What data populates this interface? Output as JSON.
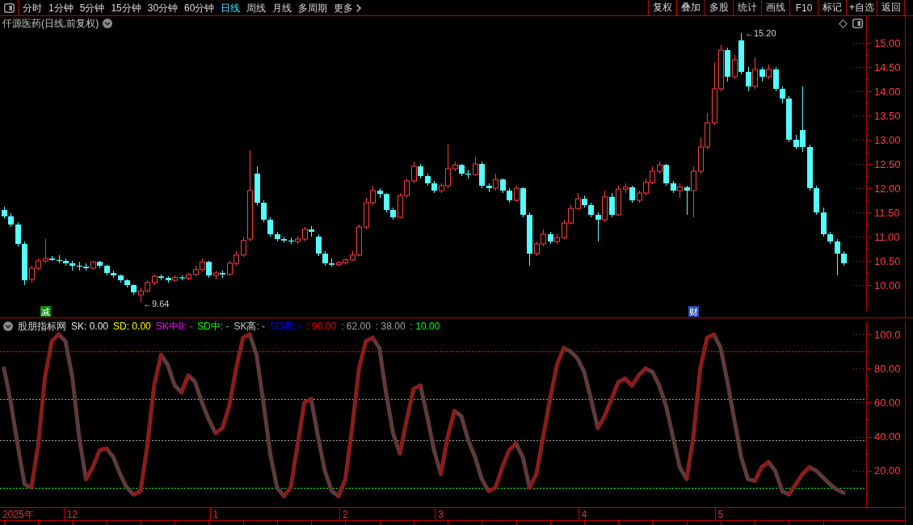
{
  "toolbar": {
    "tabs": [
      {
        "label": "分时",
        "selected": false,
        "kind": "period"
      },
      {
        "label": "1分钟",
        "selected": false,
        "kind": "period"
      },
      {
        "label": "5分钟",
        "selected": false,
        "kind": "period"
      },
      {
        "label": "15分钟",
        "selected": false,
        "kind": "period"
      },
      {
        "label": "30分钟",
        "selected": false,
        "kind": "period"
      },
      {
        "label": "60分钟",
        "selected": false,
        "kind": "period"
      },
      {
        "label": "日线",
        "selected": true,
        "kind": "period"
      },
      {
        "label": "周线",
        "selected": false,
        "kind": "period"
      },
      {
        "label": "月线",
        "selected": false,
        "kind": "period"
      },
      {
        "label": "多周期",
        "selected": false,
        "kind": "period"
      },
      {
        "label": "更多",
        "selected": false,
        "kind": "menu"
      }
    ],
    "buttons": [
      "复权",
      "叠加",
      "多股",
      "统计",
      "画线",
      "F10",
      "标记",
      "+自选",
      "返回"
    ]
  },
  "price_chart": {
    "title": "仟源医药(日线,前复权)",
    "axis_labels": [
      "15.00",
      "14.50",
      "14.00",
      "13.50",
      "13.00",
      "12.50",
      "12.00",
      "11.50",
      "11.00",
      "10.50",
      "10.00"
    ],
    "high_label": "←15.20",
    "low_label": "←9.64",
    "events": [
      {
        "label": "减",
        "color": "#0a8f0a"
      },
      {
        "label": "财",
        "color": "#2a52be"
      }
    ]
  },
  "indicator": {
    "name": "股朋指标网",
    "legend": [
      {
        "text": "SK: 0.00",
        "color": "#e6e6e6"
      },
      {
        "text": "SD: 0.00",
        "color": "#ffff00"
      },
      {
        "text": "SK中8: -",
        "color": "#ff00ff"
      },
      {
        "text": "SD中: -",
        "color": "#00ff00"
      },
      {
        "text": "SK高: -",
        "color": "#c8c8c8"
      },
      {
        "text": "SD高: -",
        "color": "#0000ff"
      },
      {
        "text": ": 90.00",
        "color": "#ff0000"
      },
      {
        "text": ": 62.00",
        "color": "#a0a0a0"
      },
      {
        "text": ": 38.00",
        "color": "#a0a0a0"
      },
      {
        "text": ": 10.00",
        "color": "#00ff00"
      }
    ],
    "year_label": "2025年",
    "chart_data": {
      "type": "line",
      "categories": [
        null,
        null,
        null,
        null,
        null,
        null,
        null,
        null,
        null,
        null,
        "12",
        null,
        null,
        null,
        null,
        null,
        null,
        null,
        null,
        null,
        null,
        null,
        null,
        null,
        null,
        null,
        null,
        null,
        null,
        null,
        null,
        "1",
        null,
        null,
        null,
        null,
        null,
        null,
        null,
        null,
        null,
        null,
        null,
        null,
        null,
        null,
        null,
        null,
        null,
        null,
        "2",
        null,
        null,
        null,
        null,
        null,
        null,
        null,
        null,
        null,
        null,
        null,
        null,
        null,
        "3",
        null,
        null,
        null,
        null,
        null,
        null,
        null,
        null,
        null,
        null,
        null,
        null,
        null,
        null,
        null,
        null,
        null,
        null,
        null,
        null,
        "4",
        null,
        null,
        null,
        null,
        null,
        null,
        null,
        null,
        null,
        null,
        null,
        null,
        null,
        null,
        null,
        null,
        null,
        null,
        null,
        "5",
        null,
        null,
        null,
        null,
        null,
        null,
        null,
        null,
        null,
        null,
        null,
        null,
        null,
        null,
        null,
        null,
        null,
        null
      ],
      "ylim": [
        -1.5,
        107.6
      ],
      "yticks": [
        {
          "value": 100,
          "label": "100.0"
        },
        {
          "value": 80,
          "label": "80.00"
        },
        {
          "value": 60,
          "label": "60.00"
        },
        {
          "value": 40,
          "label": "40.00"
        },
        {
          "value": 20,
          "label": "20.00"
        }
      ],
      "series": [
        {
          "color": "#5e3a3a",
          "values": [
            80,
            60,
            35,
            12,
            10,
            null,
            null,
            null,
            100,
            96,
            75,
            40,
            15,
            null,
            null,
            33,
            28,
            18,
            10,
            6,
            null,
            null,
            null,
            88,
            82,
            70,
            66,
            76,
            72,
            60,
            50,
            42,
            null,
            null,
            null,
            null,
            100,
            88,
            60,
            30,
            10,
            5,
            null,
            null,
            null,
            62,
            40,
            20,
            8,
            5,
            null,
            null,
            null,
            null,
            98,
            92,
            65,
            42,
            30,
            null,
            null,
            70,
            52,
            32,
            18,
            null,
            55,
            52,
            38,
            28,
            15,
            8,
            null,
            null,
            null,
            36,
            28,
            10,
            null,
            null,
            null,
            null,
            92,
            90,
            86,
            78,
            62,
            45,
            null,
            null,
            null,
            74,
            70,
            null,
            80,
            78,
            70,
            58,
            40,
            22,
            15,
            null,
            null,
            null,
            100,
            92,
            72,
            50,
            28,
            15,
            14,
            null,
            25,
            20,
            8,
            6,
            null,
            null,
            22,
            20,
            16,
            12,
            9,
            7
          ]
        },
        {
          "color": "#8c1c1c",
          "values": [
            null,
            null,
            null,
            null,
            10,
            35,
            75,
            96,
            100,
            null,
            null,
            null,
            15,
            22,
            32,
            33,
            null,
            null,
            null,
            6,
            8,
            35,
            70,
            88,
            null,
            null,
            66,
            76,
            null,
            null,
            null,
            42,
            45,
            58,
            80,
            98,
            100,
            null,
            null,
            null,
            null,
            5,
            10,
            35,
            60,
            62,
            null,
            null,
            null,
            5,
            15,
            45,
            80,
            96,
            98,
            null,
            null,
            null,
            30,
            50,
            68,
            70,
            null,
            null,
            18,
            40,
            55,
            null,
            null,
            null,
            null,
            8,
            10,
            22,
            32,
            36,
            null,
            10,
            18,
            40,
            62,
            82,
            92,
            null,
            null,
            null,
            null,
            45,
            52,
            62,
            72,
            74,
            70,
            76,
            80,
            null,
            null,
            null,
            null,
            null,
            15,
            40,
            80,
            98,
            100,
            null,
            null,
            null,
            null,
            null,
            14,
            22,
            25,
            null,
            null,
            6,
            12,
            18,
            22,
            null,
            null,
            null,
            null,
            null
          ]
        }
      ],
      "ref_lines": [
        {
          "axis": "y",
          "value": 90,
          "color": "#ff0000"
        },
        {
          "axis": "y",
          "value": 62,
          "color": "#a0a0a0"
        },
        {
          "axis": "y",
          "value": 38,
          "color": "#a0a0a0"
        },
        {
          "axis": "y",
          "value": 10,
          "color": "#00ff00"
        }
      ]
    }
  }
}
